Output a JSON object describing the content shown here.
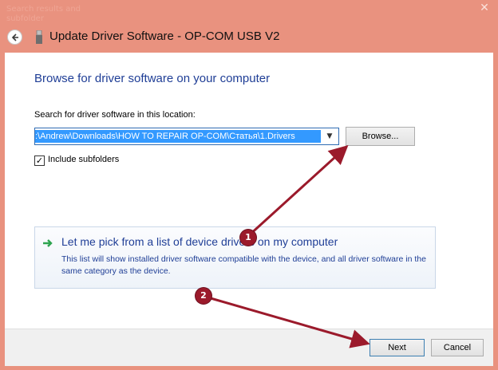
{
  "window": {
    "title": "Update Driver Software - OP-COM USB V2",
    "background_text": "Search results and subfolder"
  },
  "page": {
    "heading": "Browse for driver software on your computer",
    "search_label": "Search for driver software in this location:",
    "path_value": ":\\Andrew\\Downloads\\HOW TO REPAIR OP-COM\\Статья\\1.Drivers",
    "browse_label": "Browse...",
    "include_subfolders": {
      "label": "Include subfolders",
      "checked": true
    }
  },
  "command_link": {
    "title": "Let me pick from a list of device drivers on my computer",
    "description": "This list will show installed driver software compatible with the device, and all driver software in the same category as the device."
  },
  "footer": {
    "next_label": "Next",
    "cancel_label": "Cancel"
  },
  "annotations": {
    "marker_1": "1",
    "marker_2": "2",
    "arrow_color": "#9b1a2b"
  },
  "colors": {
    "link_blue": "#1f3e96",
    "selection_blue": "#3399ff",
    "window_frame": "#e9927f"
  }
}
